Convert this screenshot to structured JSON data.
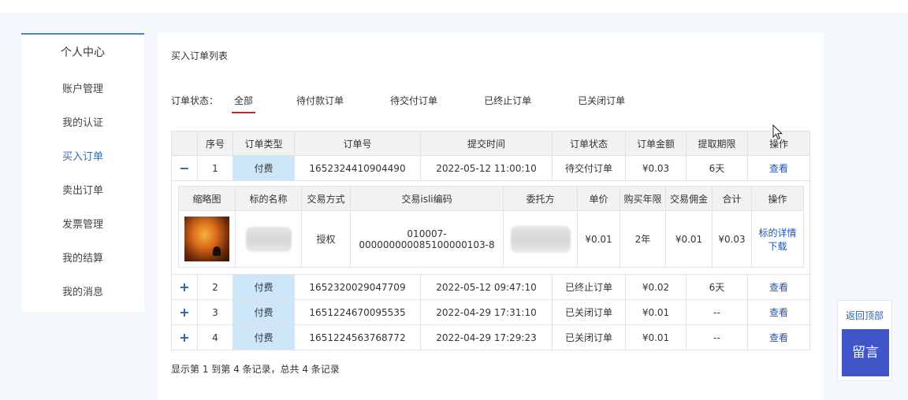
{
  "sidebar": {
    "title": "个人中心",
    "items": [
      {
        "label": "账户管理"
      },
      {
        "label": "我的认证"
      },
      {
        "label": "买入订单"
      },
      {
        "label": "卖出订单"
      },
      {
        "label": "发票管理"
      },
      {
        "label": "我的结算"
      },
      {
        "label": "我的消息"
      }
    ],
    "active_index": 2
  },
  "main": {
    "title": "买入订单列表",
    "filter_label": "订单状态：",
    "filters": [
      "全部",
      "待付款订单",
      "待交付订单",
      "已终止订单",
      "已关闭订单"
    ],
    "active_filter": "全部"
  },
  "orders": {
    "headers": [
      "",
      "序号",
      "订单类型",
      "订单号",
      "提交时间",
      "订单状态",
      "订单金额",
      "提取期限",
      "操作"
    ],
    "rows": [
      {
        "toggle": "−",
        "index": "1",
        "type": "付费",
        "order_no": "1652324410904490",
        "submitted": "2022-05-12 11:00:10",
        "status": "待交付订单",
        "amount": "¥0.03",
        "period": "6天",
        "action": "查看"
      },
      {
        "toggle": "+",
        "index": "2",
        "type": "付费",
        "order_no": "1652320029047709",
        "submitted": "2022-05-12 09:47:10",
        "status": "已终止订单",
        "amount": "¥0.02",
        "period": "6天",
        "action": "查看"
      },
      {
        "toggle": "+",
        "index": "3",
        "type": "付费",
        "order_no": "1651224670095535",
        "submitted": "2022-04-29 17:31:10",
        "status": "已关闭订单",
        "amount": "¥0.01",
        "period": "--",
        "action": "查看"
      },
      {
        "toggle": "+",
        "index": "4",
        "type": "付费",
        "order_no": "1651224563768772",
        "submitted": "2022-04-29 17:29:23",
        "status": "已关闭订单",
        "amount": "¥0.01",
        "period": "--",
        "action": "查看"
      }
    ]
  },
  "detail": {
    "headers": [
      "缩略图",
      "标的名称",
      "交易方式",
      "交易isli编码",
      "委托方",
      "单价",
      "购买年限",
      "交易佣金",
      "合计",
      "操作"
    ],
    "row": {
      "method": "授权",
      "isli_line1": "010007-",
      "isli_line2": "000000000085100000103-8",
      "price": "¥0.01",
      "years": "2年",
      "commission": "¥0.01",
      "total": "¥0.03",
      "action_line1": "标的详情",
      "action_line2": "下载"
    }
  },
  "summary": "显示第 1 到第 4 条记录，总共 4 条记录",
  "float": {
    "back_top": "返回顶部",
    "message": "留言"
  },
  "colors": {
    "accent": "#2f6db5",
    "link": "#1f55b5",
    "active_tab_underline": "#b32d2d",
    "type_cell_bg": "#cde6f8",
    "message_button": "#3f55c8"
  }
}
